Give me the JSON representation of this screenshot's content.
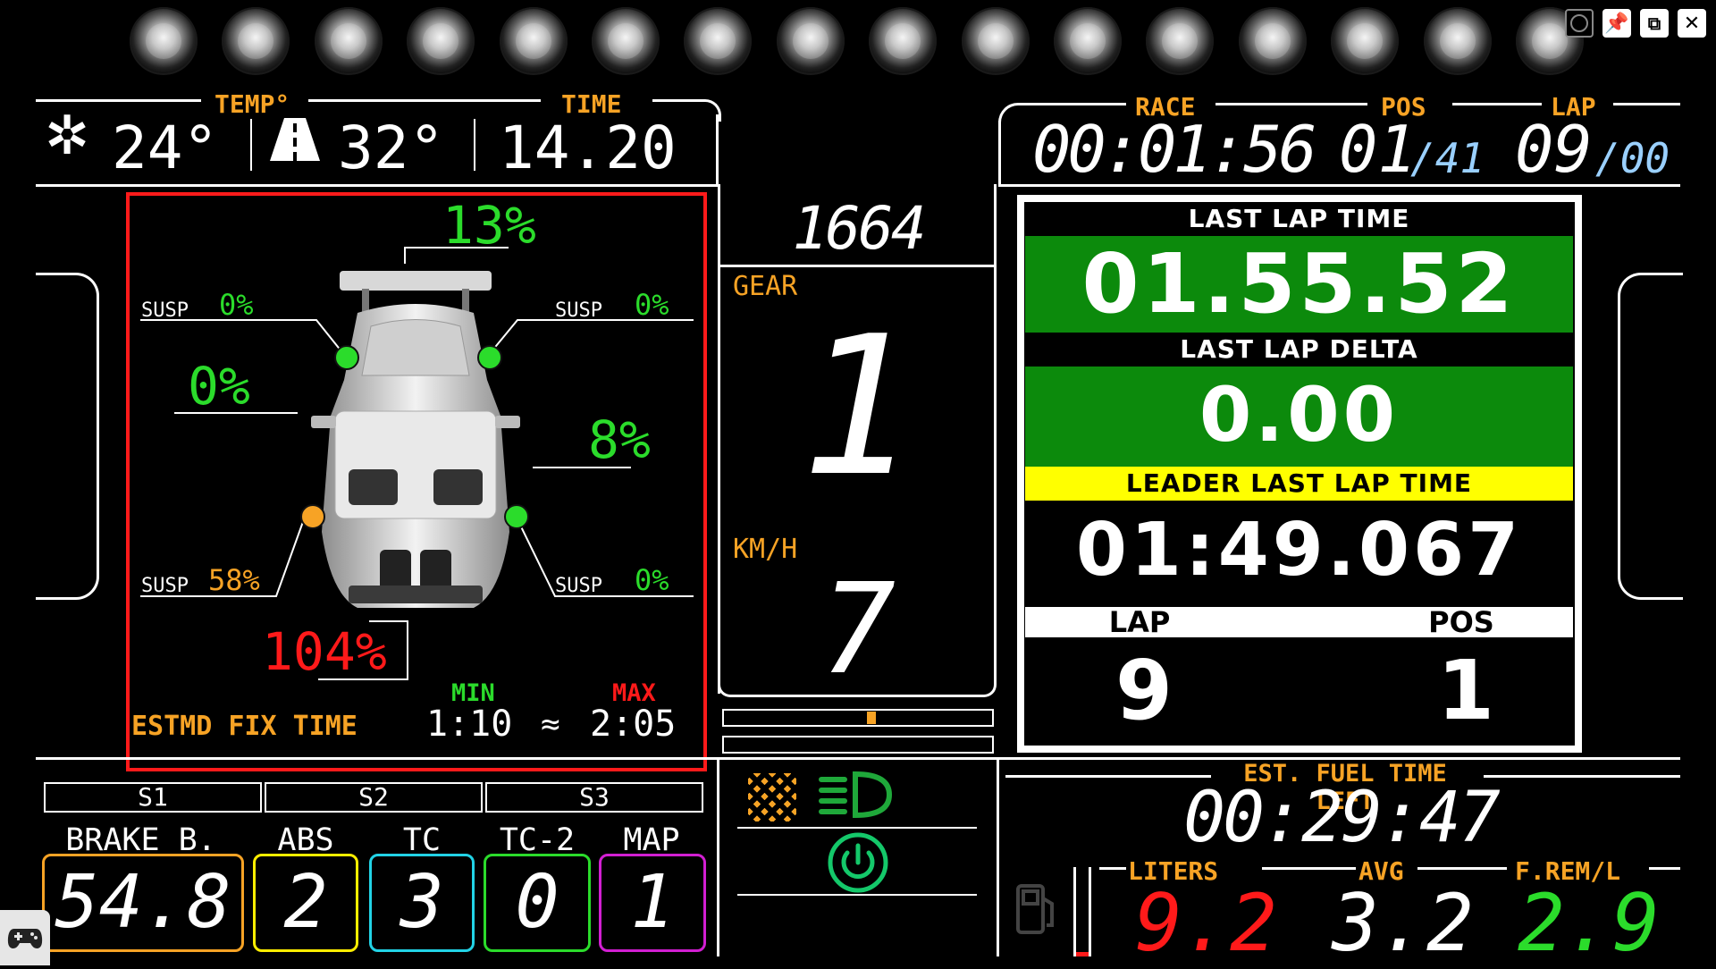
{
  "window_controls": {
    "record_icon": "record-icon",
    "pin_icon": "pin-icon",
    "popout_icon": "popout-icon",
    "close_icon": "close-icon"
  },
  "leds": {
    "count": 16
  },
  "top_left": {
    "temp_label": "TEMP°",
    "time_label": "TIME",
    "air_temp": "24°",
    "track_temp": "32°",
    "time": "14.20"
  },
  "top_right": {
    "race_label": "RACE",
    "pos_label": "POS",
    "lap_label": "LAP",
    "race_time": "00:01:56",
    "pos": "01",
    "pos_total": "/41",
    "lap": "09",
    "lap_total": "/00"
  },
  "tyres": {
    "rear_wing_pct": "13%",
    "susp_label": "SUSP",
    "susp_fl": "0%",
    "susp_fr": "0%",
    "susp_rl": "58%",
    "susp_rr": "0%",
    "left_pct": "0%",
    "right_pct": "8%",
    "front_pct": "104%",
    "estmd_label": "ESTMD FIX TIME",
    "min_label": "MIN",
    "max_label": "MAX",
    "min_time": "1:10",
    "approx": "≈",
    "max_time": "2:05",
    "colors": {
      "ok": "#2bdc2b",
      "warn": "#f7a325",
      "crit": "#ff1a1a"
    }
  },
  "center": {
    "rpm": "1664",
    "gear_label": "GEAR",
    "gear": "1",
    "speed_label": "KM/H",
    "speed": "7"
  },
  "lap_panel": {
    "last_lap_label": "LAST LAP TIME",
    "last_lap": "01.55.52",
    "delta_label": "LAST LAP DELTA",
    "delta": "0.00",
    "leader_label": "LEADER LAST LAP TIME",
    "leader_time": "01:49.067",
    "lap_label": "LAP",
    "pos_label": "POS",
    "lap": "9",
    "pos": "1",
    "green": "#0c8a0c",
    "yellow": "#ffff00"
  },
  "sectors": [
    "S1",
    "S2",
    "S3"
  ],
  "knobs": [
    {
      "label": "BRAKE B.",
      "value": "54.8",
      "color": "#f7a325"
    },
    {
      "label": "ABS",
      "value": "2",
      "color": "#ffee00"
    },
    {
      "label": "TC",
      "value": "3",
      "color": "#22d3e6"
    },
    {
      "label": "TC-2",
      "value": "0",
      "color": "#2bdc2b"
    },
    {
      "label": "MAP",
      "value": "1",
      "color": "#d21fd2"
    }
  ],
  "indicators": {
    "flag_icon": "checkered-flag-icon",
    "lights_icon": "headlights-icon",
    "ignition_icon": "power-icon"
  },
  "fuel": {
    "est_label": "EST. FUEL TIME LEFT",
    "est_time": "00:29:47",
    "liters_label": "LITERS",
    "avg_label": "AVG",
    "frem_label": "F.REM/L",
    "liters": "9.2",
    "avg": "3.2",
    "frem": "2.9",
    "fuel_level_fraction": 0.05
  },
  "taskbar": {
    "gamepad_icon": "gamepad-icon"
  }
}
